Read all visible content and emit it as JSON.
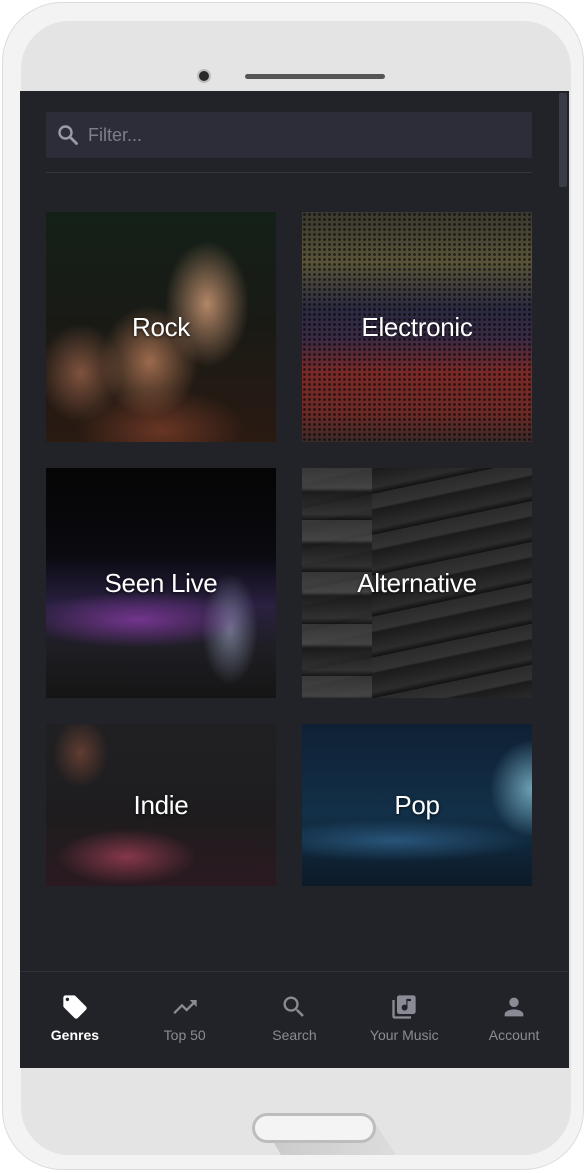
{
  "filter": {
    "placeholder": "Filter..."
  },
  "genres": [
    {
      "label": "Rock"
    },
    {
      "label": "Electronic"
    },
    {
      "label": "Seen Live"
    },
    {
      "label": "Alternative"
    },
    {
      "label": "Indie"
    },
    {
      "label": "Pop"
    }
  ],
  "nav": [
    {
      "label": "Genres",
      "icon": "tag-icon",
      "active": true
    },
    {
      "label": "Top 50",
      "icon": "trending-up-icon",
      "active": false
    },
    {
      "label": "Search",
      "icon": "search-icon",
      "active": false
    },
    {
      "label": "Your Music",
      "icon": "library-music-icon",
      "active": false
    },
    {
      "label": "Account",
      "icon": "person-icon",
      "active": false
    }
  ],
  "colors": {
    "screen_bg": "#222329",
    "filter_bg": "#2c2d38",
    "nav_active": "#ffffff",
    "nav_inactive": "#8a8b94"
  }
}
